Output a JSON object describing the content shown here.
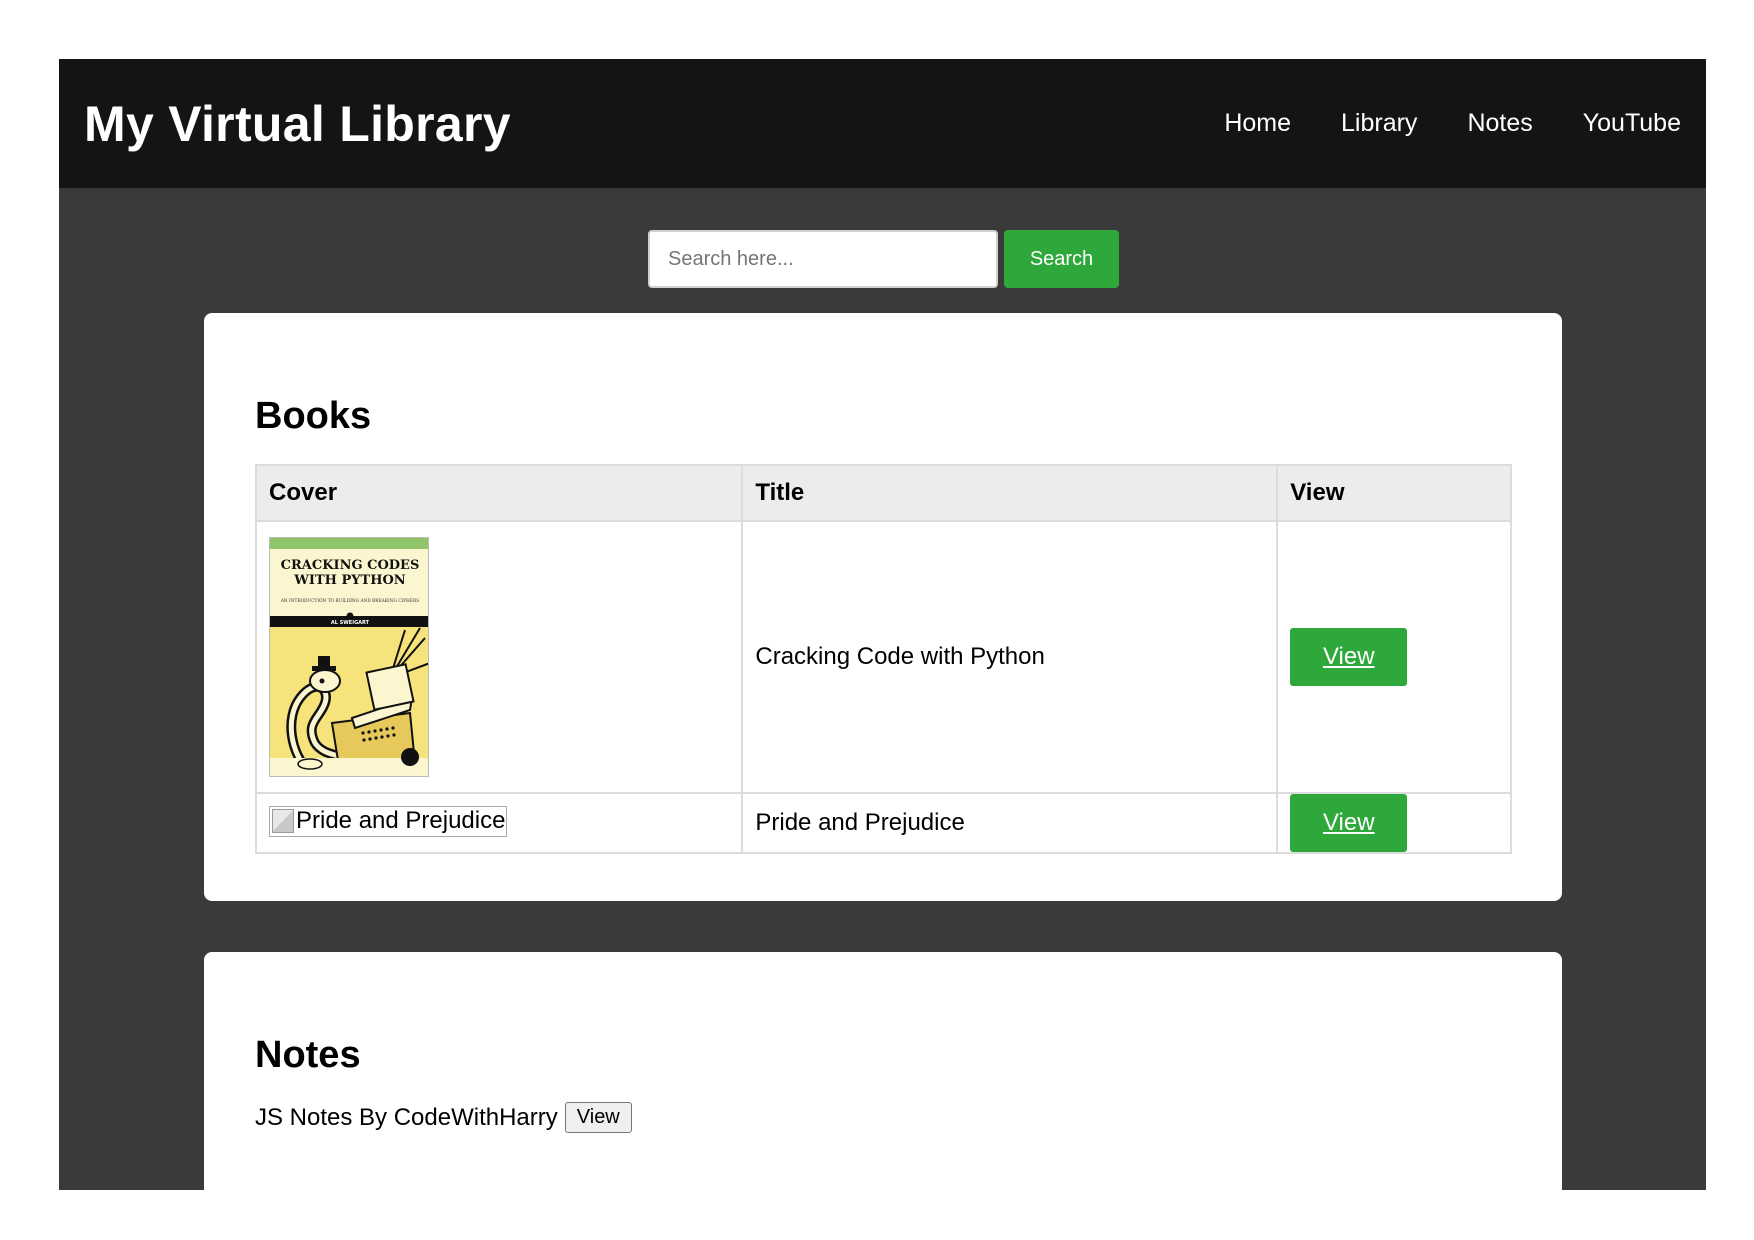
{
  "site": {
    "title": "My Virtual Library"
  },
  "nav": {
    "items": [
      {
        "label": "Home"
      },
      {
        "label": "Library"
      },
      {
        "label": "Notes"
      },
      {
        "label": "YouTube"
      }
    ]
  },
  "search": {
    "placeholder": "Search here...",
    "value": "",
    "button_label": "Search"
  },
  "books": {
    "heading": "Books",
    "columns": [
      "Cover",
      "Title",
      "View"
    ],
    "rows": [
      {
        "cover_title_line1": "CRACKING CODES",
        "cover_title_line2": "WITH PYTHON",
        "cover_subtitle": "AN INTRODUCTION TO BUILDING AND BREAKING CIPHERS",
        "cover_author": "AL SWEIGART",
        "title": "Cracking Code with Python",
        "view_label": "View"
      },
      {
        "cover_alt": "Pride and Prejudice",
        "title": "Pride and Prejudice",
        "view_label": "View"
      }
    ]
  },
  "notes": {
    "heading": "Notes",
    "items": [
      {
        "label": "JS Notes By CodeWithHarry",
        "view_label": "View"
      }
    ]
  },
  "colors": {
    "navbar": "#141414",
    "background": "#3a3a3a",
    "accent_green": "#2ea83a"
  }
}
